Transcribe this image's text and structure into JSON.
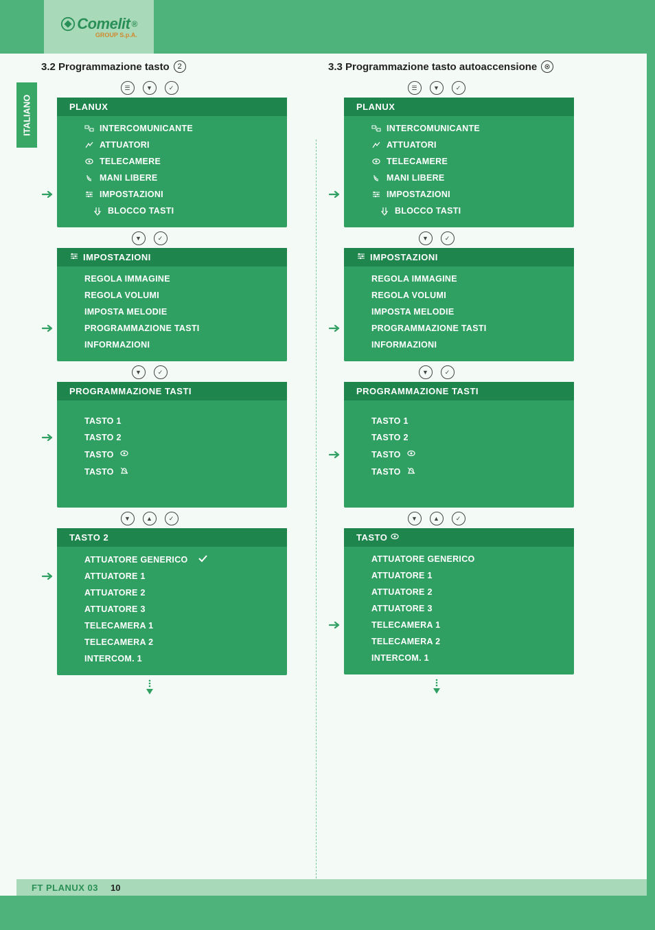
{
  "brand": {
    "name": "Comelit",
    "sub": "GROUP S.p.A."
  },
  "language_tab": "ITALIANO",
  "footer": {
    "doc": "FT PLANUX 03",
    "page": "10"
  },
  "sections": {
    "left": {
      "title_prefix": "3.2 Programmazione tasto",
      "title_badge": "2"
    },
    "right": {
      "title_prefix": "3.3 Programmazione tasto autoaccensione"
    }
  },
  "menus": {
    "planux": {
      "header": "PLANUX",
      "items": [
        {
          "label": "INTERCOMUNICANTE",
          "icon": "intercom"
        },
        {
          "label": "ATTUATORI",
          "icon": "actuator"
        },
        {
          "label": "TELECAMERE",
          "icon": "camera"
        },
        {
          "label": "MANI LIBERE",
          "icon": "handsfree"
        },
        {
          "label": "IMPOSTAZIONI",
          "icon": "settings",
          "arrow": true
        },
        {
          "label": "BLOCCO TASTI",
          "icon": "lock",
          "indent": true
        }
      ]
    },
    "impostazioni": {
      "header": "IMPOSTAZIONI",
      "header_icon": "settings",
      "items": [
        {
          "label": "REGOLA IMMAGINE"
        },
        {
          "label": "REGOLA VOLUMI"
        },
        {
          "label": "IMPOSTA MELODIE"
        },
        {
          "label": "PROGRAMMAZIONE TASTI",
          "arrow": true
        },
        {
          "label": "INFORMAZIONI"
        }
      ]
    },
    "prog_tasti_left": {
      "header": "PROGRAMMAZIONE TASTI",
      "items": [
        {
          "label": "TASTO 1"
        },
        {
          "label": "TASTO 2",
          "arrow": true
        },
        {
          "label": "TASTO",
          "suffix_icon": "camera"
        },
        {
          "label": "TASTO",
          "suffix_icon": "bell"
        }
      ]
    },
    "prog_tasti_right": {
      "header": "PROGRAMMAZIONE TASTI",
      "items": [
        {
          "label": "TASTO 1"
        },
        {
          "label": "TASTO 2"
        },
        {
          "label": "TASTO",
          "suffix_icon": "camera",
          "arrow": true
        },
        {
          "label": "TASTO",
          "suffix_icon": "bell"
        }
      ]
    },
    "tasto2": {
      "header": "TASTO 2",
      "items": [
        {
          "label": "ATTUATORE GENERICO",
          "check": true
        },
        {
          "label": "ATTUATORE 1",
          "arrow": true
        },
        {
          "label": "ATTUATORE 2"
        },
        {
          "label": "ATTUATORE 3"
        },
        {
          "label": "TELECAMERA 1"
        },
        {
          "label": "TELECAMERA 2"
        },
        {
          "label": "INTERCOM. 1"
        }
      ]
    },
    "tasto_cam": {
      "header": "TASTO",
      "header_suffix_icon": "camera",
      "items": [
        {
          "label": "ATTUATORE GENERICO"
        },
        {
          "label": "ATTUATORE 1"
        },
        {
          "label": "ATTUATORE 2"
        },
        {
          "label": "ATTUATORE 3"
        },
        {
          "label": "TELECAMERA 1",
          "arrow": true
        },
        {
          "label": "TELECAMERA 2"
        },
        {
          "label": "INTERCOM. 1"
        }
      ]
    }
  }
}
